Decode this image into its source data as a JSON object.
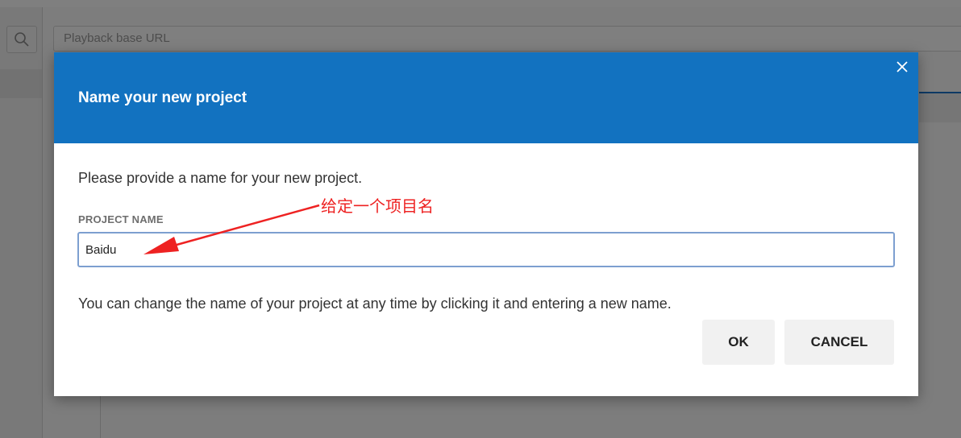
{
  "background_app": {
    "playback_url_placeholder": "Playback base URL",
    "search_icon": "search-icon"
  },
  "dialog": {
    "title": "Name your new project",
    "close_icon": "close-icon",
    "prompt": "Please provide a name for your new project.",
    "field_label": "PROJECT NAME",
    "field_value": "Baidu",
    "hint": "You can change the name of your project at any time by clicking it and entering a new name.",
    "ok_label": "OK",
    "cancel_label": "CANCEL"
  },
  "annotation": {
    "text": "给定一个项目名",
    "color": "#ee2222"
  },
  "colors": {
    "header": "#1272c0",
    "input_border": "#7d9fd0"
  }
}
